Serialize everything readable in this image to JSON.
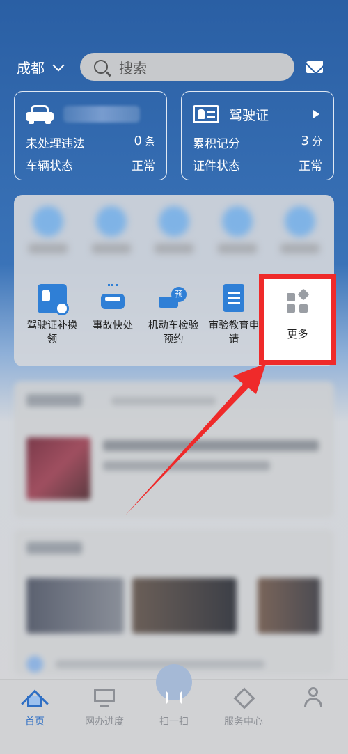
{
  "header": {
    "city": "成都",
    "search_placeholder": "搜索"
  },
  "vehicle_card": {
    "violations_label": "未处理违法",
    "violations_count": "0",
    "violations_unit": "条",
    "status_label": "车辆状态",
    "status_value": "正常"
  },
  "license_card": {
    "title": "驾驶证",
    "points_label": "累积记分",
    "points_value": "3",
    "points_unit": "分",
    "status_label": "证件状态",
    "status_value": "正常"
  },
  "services": [
    {
      "label": "驾驶证补换领",
      "icon": "license-swap-icon"
    },
    {
      "label": "事故快处",
      "icon": "accident-icon"
    },
    {
      "label": "机动车检验预约",
      "icon": "inspection-booking-icon"
    },
    {
      "label": "审验教育申请",
      "icon": "document-icon"
    },
    {
      "label": "更多",
      "icon": "more-grid-icon"
    }
  ],
  "tabbar": [
    {
      "label": "首页",
      "icon": "home-icon"
    },
    {
      "label": "网办进度",
      "icon": "monitor-icon"
    },
    {
      "label": "扫一扫",
      "icon": "scan-icon"
    },
    {
      "label": "服务中心",
      "icon": "service-center-icon"
    },
    {
      "label": "",
      "icon": "user-icon"
    }
  ],
  "colors": {
    "brand": "#2a5fa4",
    "accent": "#2f7fd6",
    "highlight": "#ef2a2a"
  }
}
